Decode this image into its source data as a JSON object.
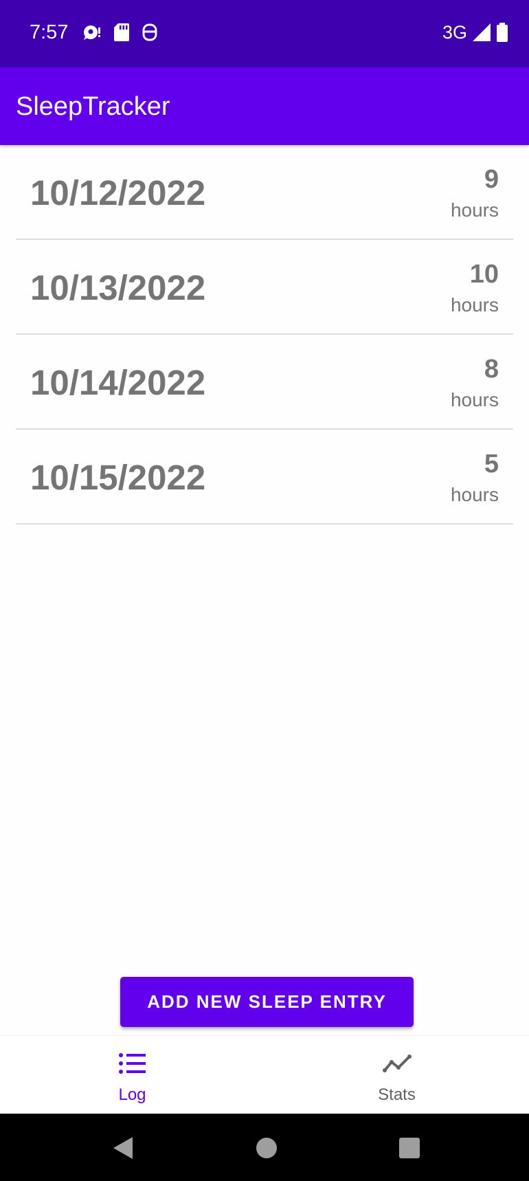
{
  "status_bar": {
    "time": "7:57",
    "left_icons": [
      "chat-bubble-icon",
      "sd-card-icon",
      "lookout-icon"
    ],
    "network_type": "3G",
    "right_icons": [
      "signal-icon",
      "battery-icon"
    ]
  },
  "app_bar": {
    "title": "SleepTracker"
  },
  "entries": [
    {
      "date": "10/12/2022",
      "hours": "9",
      "unit": "hours"
    },
    {
      "date": "10/13/2022",
      "hours": "10",
      "unit": "hours"
    },
    {
      "date": "10/14/2022",
      "hours": "8",
      "unit": "hours"
    },
    {
      "date": "10/15/2022",
      "hours": "5",
      "unit": "hours"
    }
  ],
  "add_button": {
    "label": "ADD NEW SLEEP ENTRY"
  },
  "bottom_nav": {
    "items": [
      {
        "label": "Log",
        "icon": "list-icon",
        "selected": true
      },
      {
        "label": "Stats",
        "icon": "trend-icon",
        "selected": false
      }
    ]
  },
  "colors": {
    "status_bar": "#3f00b0",
    "primary": "#6200ee",
    "text_gray": "#757575",
    "divider": "#dddddd",
    "nav_inactive": "#616161"
  },
  "system_nav": {
    "icons": [
      "back-icon",
      "home-icon",
      "recents-icon"
    ]
  }
}
